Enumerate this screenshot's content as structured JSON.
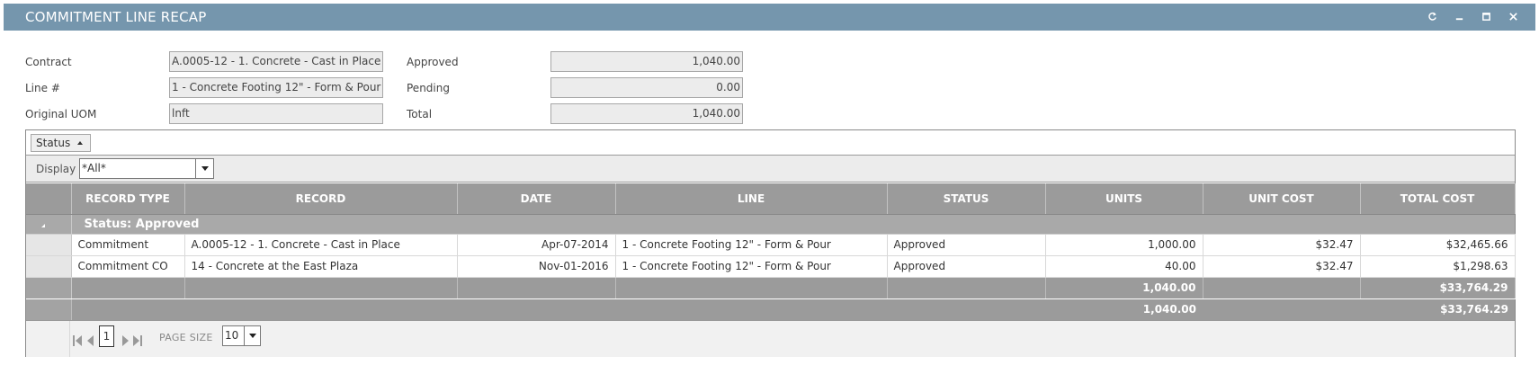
{
  "window": {
    "title": "COMMITMENT LINE RECAP",
    "controls": [
      "refresh-icon",
      "minimize-icon",
      "maximize-icon",
      "close-icon"
    ]
  },
  "form": {
    "contract_label": "Contract",
    "contract_value": "A.0005-12 - 1. Concrete - Cast in Place",
    "line_label": "Line #",
    "line_value": "1 - Concrete Footing 12\" - Form & Pour",
    "uom_label": "Original UOM",
    "uom_value": "lnft",
    "approved_label": "Approved",
    "approved_value": "1,040.00",
    "pending_label": "Pending",
    "pending_value": "0.00",
    "total_label": "Total",
    "total_value": "1,040.00"
  },
  "grid": {
    "group_chip": "Status",
    "display_label": "Display",
    "display_value": "*All*",
    "columns": [
      "RECORD TYPE",
      "RECORD",
      "DATE",
      "LINE",
      "STATUS",
      "UNITS",
      "UNIT COST",
      "TOTAL COST"
    ],
    "group_title": "Status: Approved",
    "rows": [
      {
        "record_type": "Commitment",
        "record": "A.0005-12 - 1. Concrete - Cast in Place",
        "date": "Apr-07-2014",
        "line": "1 - Concrete Footing 12\" - Form & Pour",
        "status": "Approved",
        "units": "1,000.00",
        "unit_cost": "$32.47",
        "total_cost": "$32,465.66"
      },
      {
        "record_type": "Commitment CO",
        "record": "14 - Concrete at the East Plaza",
        "date": "Nov-01-2016",
        "line": "1 - Concrete Footing 12\" - Form & Pour",
        "status": "Approved",
        "units": "40.00",
        "unit_cost": "$32.47",
        "total_cost": "$1,298.63"
      }
    ],
    "subtotal_units": "1,040.00",
    "subtotal_cost": "$33,764.29",
    "total_units": "1,040.00",
    "total_cost": "$33,764.29"
  },
  "pager": {
    "page": "1",
    "page_size_label": "PAGE SIZE",
    "page_size": "10"
  },
  "colors": {
    "titlebar": "#7596ad",
    "header": "#9b9b9b",
    "group_row": "#a9a9a9"
  }
}
